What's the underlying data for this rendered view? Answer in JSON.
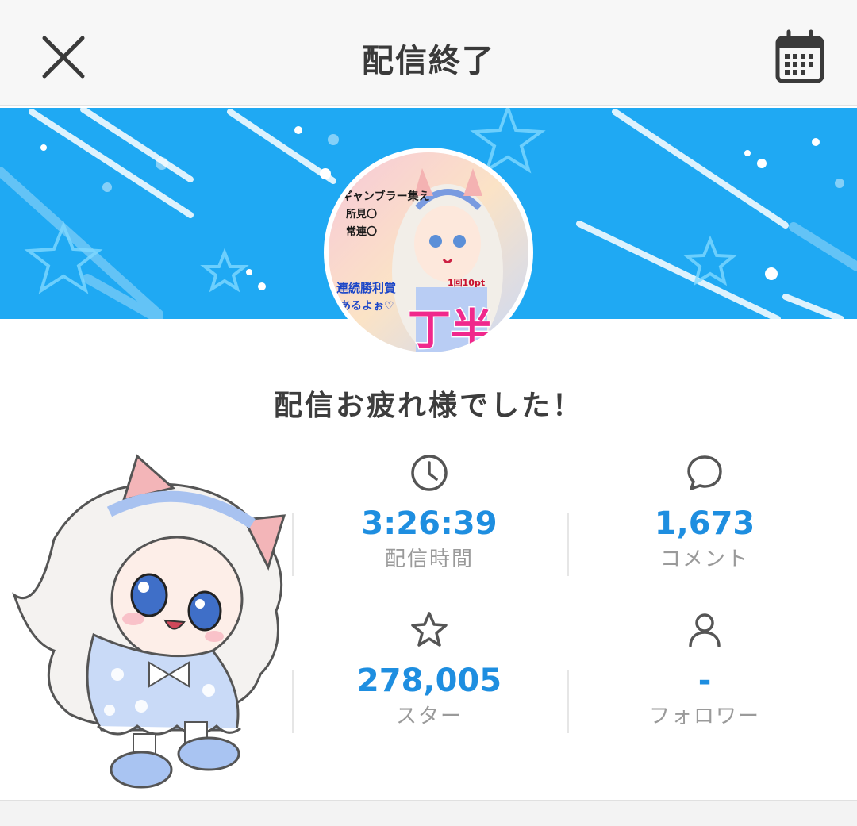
{
  "header": {
    "title": "配信終了",
    "close_icon": "close-icon",
    "calendar_icon": "calendar-icon"
  },
  "banner": {
    "color": "#1fa9f3",
    "avatar_texts": [
      "ギャンブラー集え",
      "所見〇",
      "常連〇",
      "連続勝利賞",
      "あるよぉ♡",
      "1回10pt",
      "丁半"
    ]
  },
  "message": "配信お疲れ様でした！",
  "stats": [
    {
      "icon": "clock-icon",
      "value": "3:26:39",
      "label": "配信時間"
    },
    {
      "icon": "comment-icon",
      "value": "1,673",
      "label": "コメント"
    },
    {
      "icon": "star-icon",
      "value": "278,005",
      "label": "スター"
    },
    {
      "icon": "person-icon",
      "value": "-",
      "label": "フォロワー"
    }
  ],
  "colors": {
    "accent": "#1e8ee0",
    "label": "#9a9a9a"
  }
}
